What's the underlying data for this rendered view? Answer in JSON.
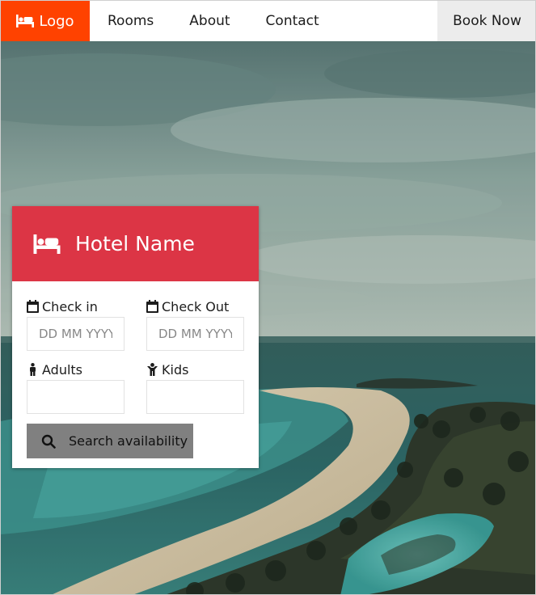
{
  "navbar": {
    "logo_label": "Logo",
    "logo_icon": "bed-icon",
    "links": [
      "Rooms",
      "About",
      "Contact"
    ],
    "cta_label": "Book Now",
    "colors": {
      "logo_bg": "#ff4200",
      "cta_bg": "#ececec"
    }
  },
  "booking": {
    "title": "Hotel Name",
    "title_icon": "bed-icon",
    "header_color": "#dc3545",
    "check_in": {
      "label": "Check in",
      "icon": "calendar-icon",
      "placeholder": "DD MM YYYY"
    },
    "check_out": {
      "label": "Check Out",
      "icon": "calendar-icon",
      "placeholder": "DD MM YYYY"
    },
    "adults": {
      "label": "Adults",
      "icon": "male-icon",
      "value": ""
    },
    "kids": {
      "label": "Kids",
      "icon": "child-icon",
      "value": ""
    },
    "search_label": "Search availability",
    "search_icon": "search-icon",
    "search_color": "#808080"
  }
}
